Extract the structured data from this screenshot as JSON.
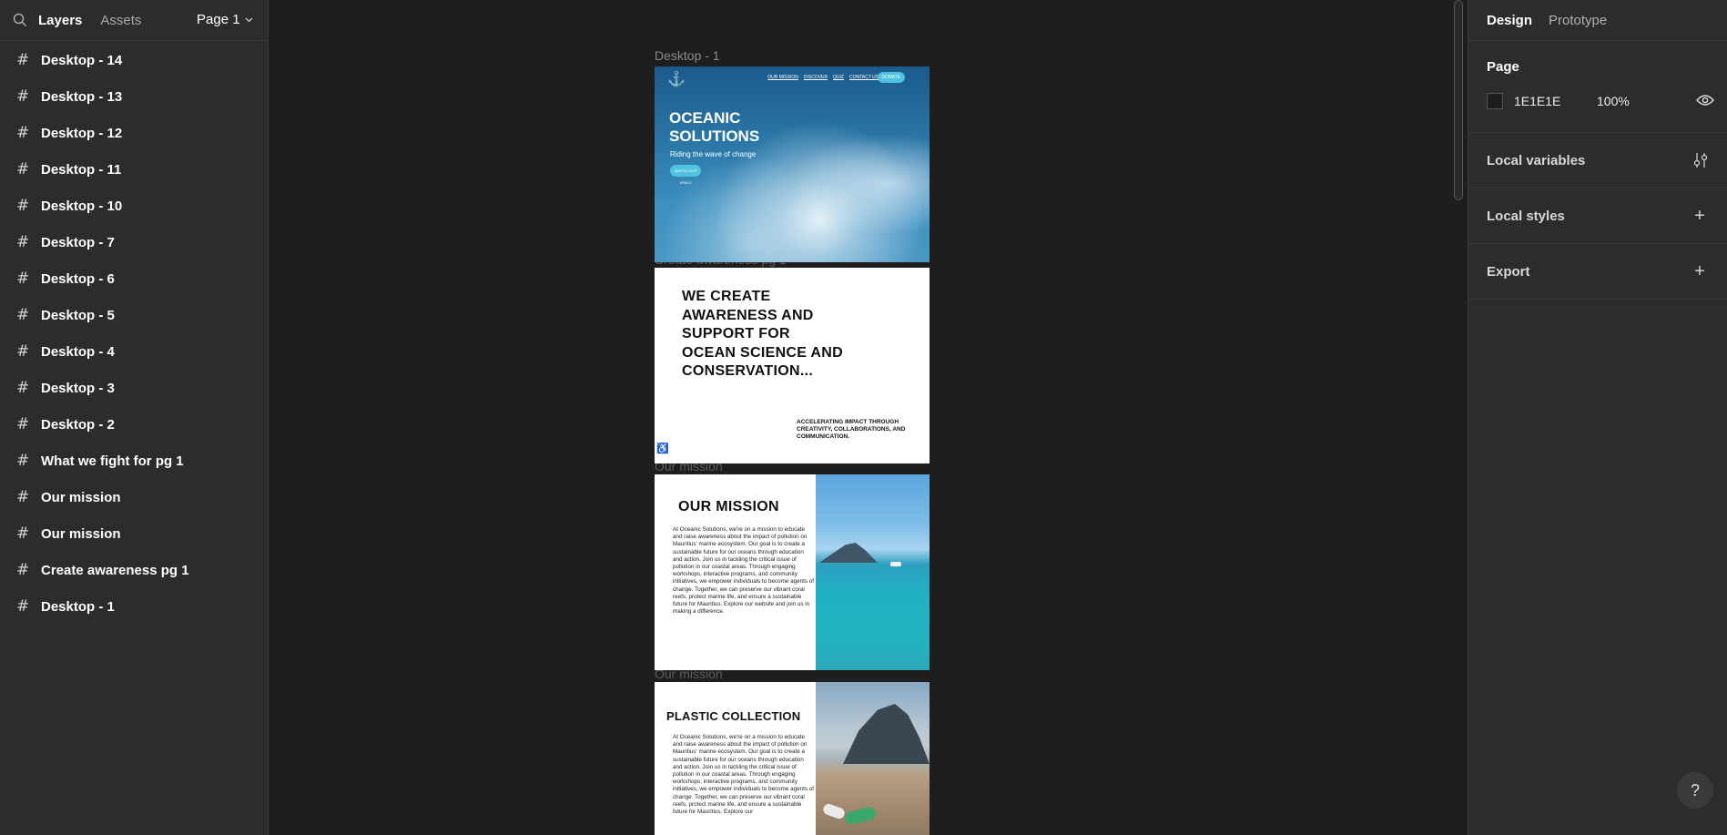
{
  "left_panel": {
    "tabs": {
      "layers": "Layers",
      "assets": "Assets"
    },
    "page_selector": "Page 1",
    "layers": [
      "Desktop - 14",
      "Desktop - 13",
      "Desktop - 12",
      "Desktop - 11",
      "Desktop - 10",
      "Desktop - 7",
      "Desktop - 6",
      "Desktop - 5",
      "Desktop - 4",
      "Desktop - 3",
      "Desktop - 2",
      "What we fight for pg 1",
      "Our mission",
      "Our mission",
      "Create awareness pg 1",
      "Desktop - 1"
    ]
  },
  "canvas": {
    "frame_labels": {
      "hero": "Desktop - 1",
      "awareness": "Create awareness pg 1",
      "mission": "Our mission",
      "plastic": "Our mission"
    },
    "hero": {
      "nav": [
        "OUR MISSION",
        "DISCOVER",
        "QUIZ",
        "CONTACT US"
      ],
      "donate": "DONATE",
      "title": "OCEANIC SOLUTIONS",
      "subtitle": "Riding the wave of change",
      "button": "WATCH OUR VIDEO"
    },
    "awareness": {
      "title": "WE CREATE AWARENESS AND SUPPORT FOR OCEAN SCIENCE AND CONSERVATION...",
      "subtitle": "ACCELERATING IMPACT THROUGH CREATIVITY, COLLABORATIONS, AND COMMUNICATION."
    },
    "mission": {
      "title": "OUR MISSION",
      "body": "At Oceanic Solutions, we're on a mission to educate and raise awareness about the impact of pollution on Mauritius' marine ecosystem. Our goal is to create a sustainable future for our oceans through education and action. Join us in tackling the critical issue of pollution in our coastal areas. Through engaging workshops, interactive programs, and community initiatives, we empower individuals to become agents of change. Together, we can preserve our vibrant coral reefs, protect marine life, and ensure a sustainable future for Mauritius. Explore our website and join us in making a difference."
    },
    "plastic": {
      "title": "PLASTIC COLLECTION",
      "body": "At Oceanic Solutions, we're on a mission to educate and raise awareness about the impact of pollution on Mauritius' marine ecosystem. Our goal is to create a sustainable future for our oceans through education and action. Join us in tackling the critical issue of pollution in our coastal areas. Through engaging workshops, interactive programs, and community initiatives, we empower individuals to become agents of change. Together, we can preserve our vibrant coral reefs, protect marine life, and ensure a sustainable future for Mauritius. Explore our"
    }
  },
  "right_panel": {
    "tabs": {
      "design": "Design",
      "prototype": "Prototype"
    },
    "page": {
      "title": "Page",
      "fill_hex": "1E1E1E",
      "fill_opacity": "100%",
      "fill_color": "#1e1e1e"
    },
    "sections": {
      "local_variables": "Local variables",
      "local_styles": "Local styles",
      "export": "Export"
    },
    "help": "?"
  },
  "colors": {
    "app_bg": "#1e1e1e",
    "panel_bg": "#2c2c2c",
    "accent_cyan": "#4fc3e0"
  }
}
